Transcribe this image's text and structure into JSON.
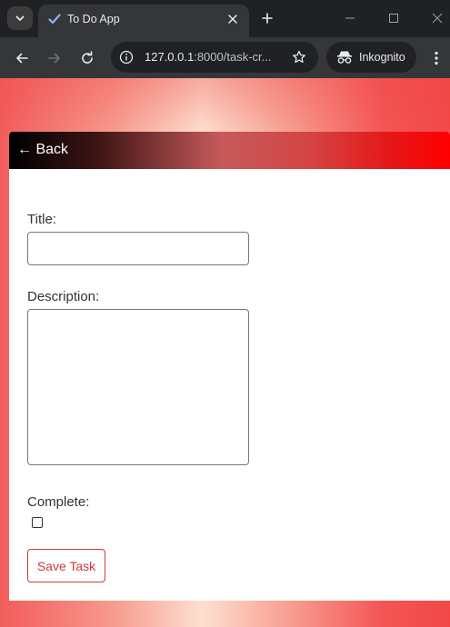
{
  "browser": {
    "tab_title": "To Do App",
    "url_host": "127.0.0.1",
    "url_rest": ":8000/task-cr...",
    "profile_label": "Inkognito",
    "icons": {
      "tab_search": "chevron-down-icon",
      "favicon": "checkmark-icon",
      "tab_close": "close-icon",
      "new_tab": "plus-icon",
      "back": "arrow-left-icon",
      "forward": "arrow-right-icon",
      "reload": "reload-icon",
      "site_info": "info-icon",
      "bookmark": "star-icon",
      "incognito": "incognito-icon",
      "menu": "kebab-menu-icon"
    }
  },
  "page": {
    "back_label": "← Back",
    "form": {
      "title_label": "Title:",
      "title_value": "",
      "description_label": "Description:",
      "description_value": "",
      "complete_label": "Complete:",
      "complete_checked": false,
      "save_label": "Save Task"
    }
  },
  "colors": {
    "accent": "#cc3a3a",
    "header_start": "#000000",
    "header_end": "#ff0000",
    "chrome_bg": "#202124",
    "chrome_toolbar": "#35363a"
  }
}
